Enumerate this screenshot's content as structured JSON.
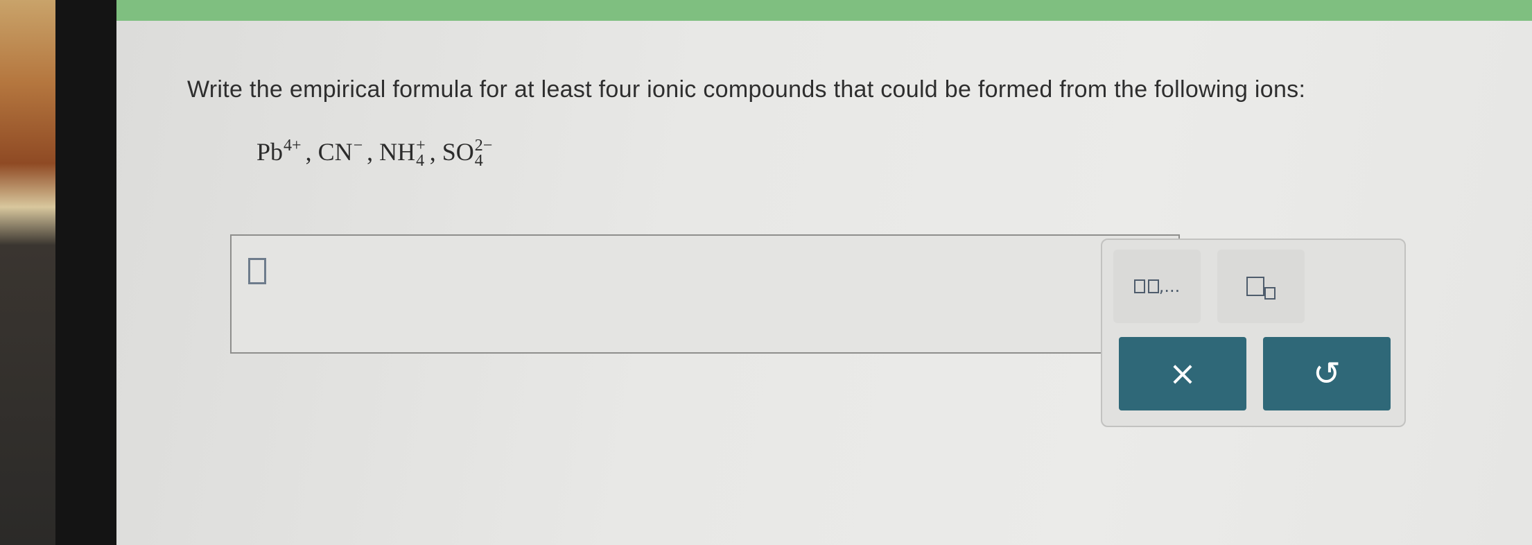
{
  "question": {
    "text": "Write the empirical formula for at least four ionic compounds that could be formed from the following ions:"
  },
  "ions": [
    {
      "base": "Pb",
      "sub": "",
      "charge": "4+"
    },
    {
      "base": "CN",
      "sub": "",
      "charge": "−"
    },
    {
      "base": "NH",
      "sub": "4",
      "charge": "+"
    },
    {
      "base": "SO",
      "sub": "4",
      "charge": "2−"
    }
  ],
  "separators": [
    ", ",
    ", ",
    ", "
  ],
  "answer": {
    "value": ""
  },
  "palette": {
    "list_label": ",...",
    "undo_icon": "↺",
    "clear_icon": "×"
  },
  "colors": {
    "topbar": "#7fbf80",
    "button_teal": "#2f6878",
    "screen_bg": "#e8e8e6"
  }
}
